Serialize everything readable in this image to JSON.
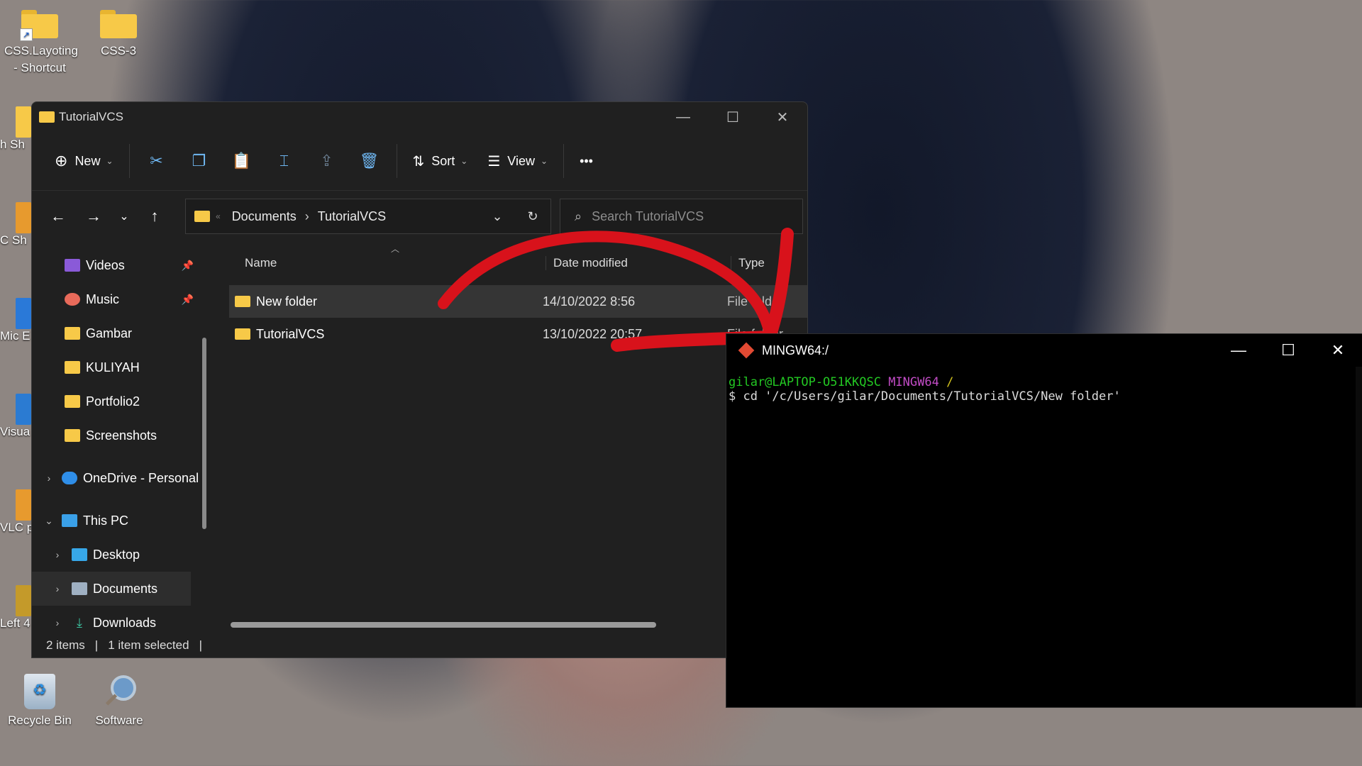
{
  "desktop": {
    "icons": [
      {
        "label": "CSS.Layoting - Shortcut",
        "icon": "folder-shortcut"
      },
      {
        "label": "CSS-3",
        "icon": "folder"
      },
      {
        "label": "Recycle Bin",
        "icon": "recycle-bin-icon"
      },
      {
        "label": "Software",
        "icon": "magnifier-icon"
      }
    ],
    "partial_icons": [
      "h Sh",
      "C Sh",
      "Mic E",
      "Visua C",
      "VLC p",
      "Left 4"
    ]
  },
  "explorer": {
    "title": "TutorialVCS",
    "toolbar": {
      "new_label": "New",
      "sort_label": "Sort",
      "view_label": "View",
      "more_label": "•••"
    },
    "address": {
      "crumbs": [
        "Documents",
        "TutorialVCS"
      ],
      "search_placeholder": "Search TutorialVCS"
    },
    "sidebar": [
      {
        "label": "Videos",
        "icon": "videos-icon",
        "pinned": true
      },
      {
        "label": "Music",
        "icon": "music-icon",
        "pinned": true
      },
      {
        "label": "Gambar",
        "icon": "folder-icon"
      },
      {
        "label": "KULIYAH",
        "icon": "folder-icon"
      },
      {
        "label": "Portfolio2",
        "icon": "folder-icon"
      },
      {
        "label": "Screenshots",
        "icon": "folder-icon"
      },
      {
        "label": "OneDrive - Personal",
        "icon": "onedrive-icon"
      },
      {
        "label": "This PC",
        "icon": "pc-icon"
      },
      {
        "label": "Desktop",
        "icon": "desktop-icon"
      },
      {
        "label": "Documents",
        "icon": "documents-icon",
        "selected": true
      },
      {
        "label": "Downloads",
        "icon": "downloads-icon"
      }
    ],
    "columns": {
      "name": "Name",
      "date": "Date modified",
      "type": "Type"
    },
    "files": [
      {
        "name": "New folder",
        "date": "14/10/2022 8:56",
        "type": "File folder",
        "selected": true
      },
      {
        "name": "TutorialVCS",
        "date": "13/10/2022 20:57",
        "type": "File folder"
      }
    ],
    "status": {
      "count": "2 items",
      "selection": "1 item selected"
    }
  },
  "terminal": {
    "title": "MINGW64:/",
    "user_host": "gilar@LAPTOP-O51KKQSC",
    "env": "MINGW64",
    "path": "/",
    "command": "$ cd '/c/Users/gilar/Documents/TutorialVCS/New folder'"
  },
  "colors": {
    "explorer_bg": "#202020",
    "accent_blue": "#6fb7f2",
    "folder_yellow": "#f7c948",
    "annotation_red": "#d8121b",
    "prompt_green": "#23c823",
    "prompt_magenta": "#c24cc6",
    "prompt_yellow": "#d2c21e"
  }
}
